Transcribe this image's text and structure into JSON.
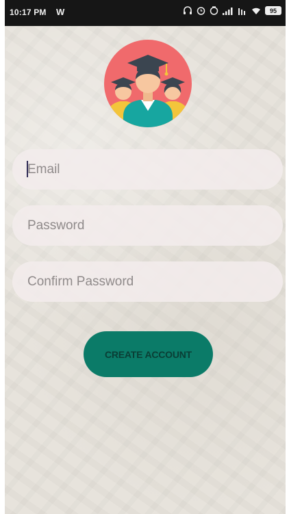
{
  "status_bar": {
    "time": "10:17 PM",
    "app_icon": "W",
    "battery": "95",
    "icons": [
      "headphones-icon",
      "alarm-icon",
      "signal-icon",
      "wifi-icon",
      "battery-icon"
    ]
  },
  "avatar": {
    "icon": "graduates-icon",
    "colors": {
      "circle": "#f06a6c",
      "gown": "#17a6a0",
      "cap": "#3b4550",
      "skin": "#f7c7a0"
    }
  },
  "form": {
    "email_placeholder": "Email",
    "password_placeholder": "Password",
    "confirm_placeholder": "Confirm Password"
  },
  "actions": {
    "create_account_label": "CREATE ACCOUNT",
    "button_color": "#0b7b68"
  },
  "colors": {
    "background": "#e7e3dc",
    "status_bar": "#161616",
    "field": "#f2ecec"
  }
}
